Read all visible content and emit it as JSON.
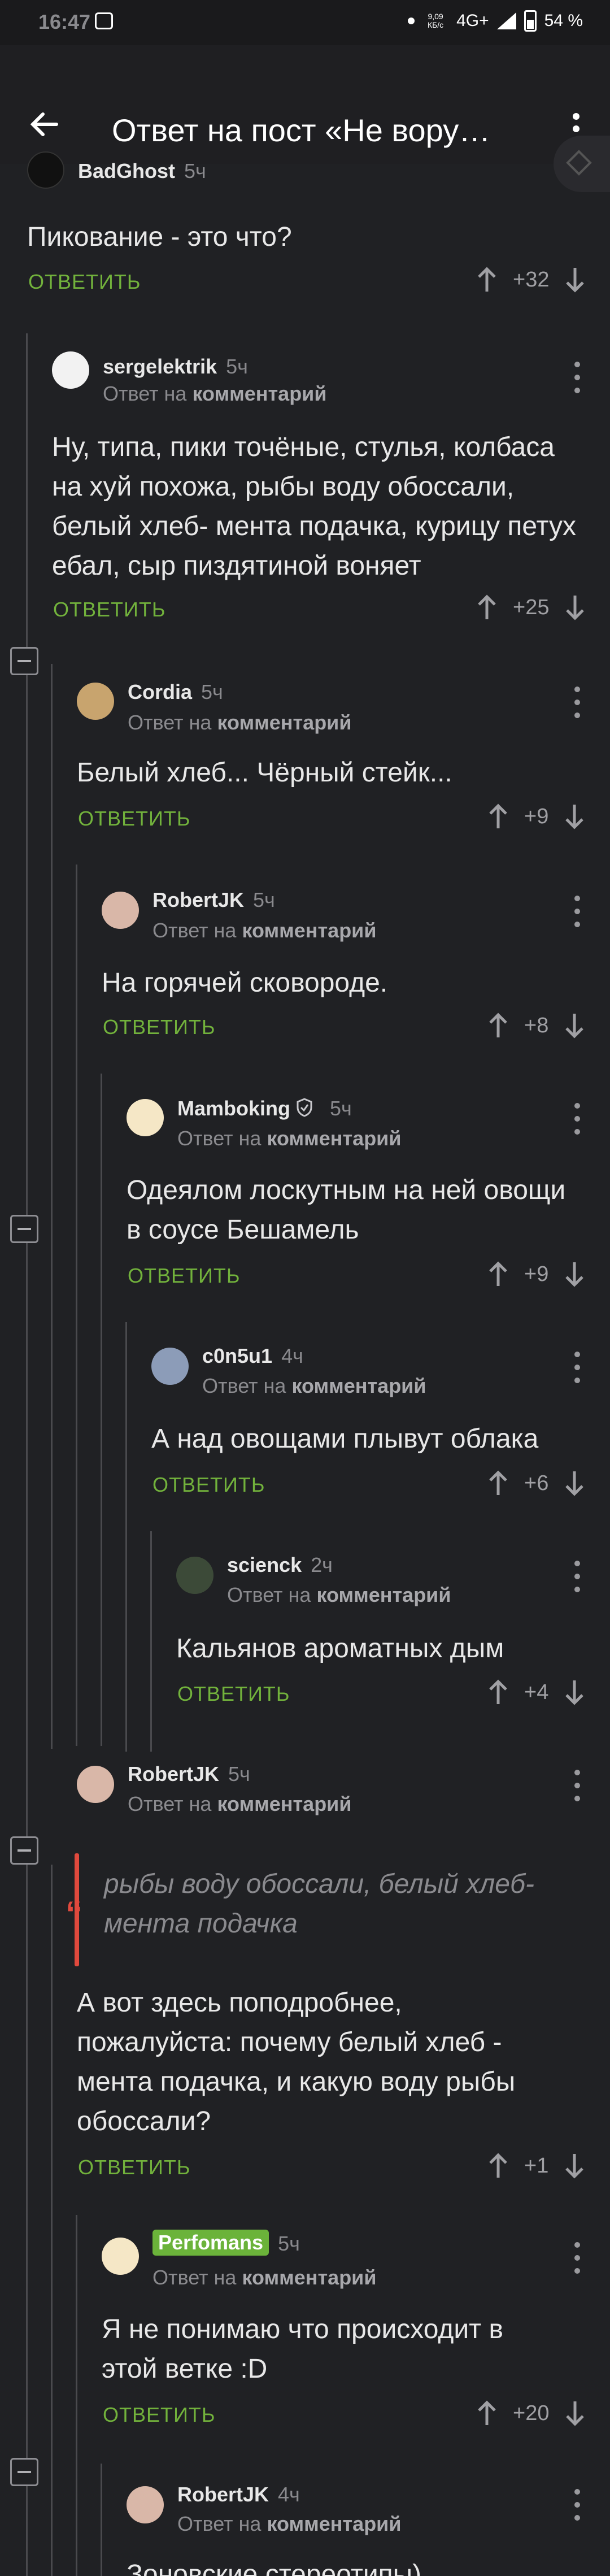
{
  "status": {
    "time": "16:47",
    "net_speed": "9,09 КБ/с",
    "network": "4G+",
    "battery": "54 %"
  },
  "appbar": {
    "title": "Ответ на пост «Не вору…"
  },
  "labels": {
    "answer": "ОТВЕТИТЬ",
    "reply_prefix": "Ответ на",
    "reply_target": "комментарий"
  },
  "comments": [
    {
      "author": "BadGhost",
      "time": "5ч",
      "text": "Пикование - это что?",
      "votes": "+32"
    },
    {
      "author": "sergelektrik",
      "time": "5ч",
      "text": "Ну, типа, пики точёные, стулья, колбаса на хуй похожа, рыбы воду обоссали, белый хлеб- мента подачка, курицу петух ебал, сыр пиздятиной воняет",
      "votes": "+25"
    },
    {
      "author": "Cordia",
      "time": "5ч",
      "text": "Белый хлеб... Чёрный стейк...",
      "votes": "+9"
    },
    {
      "author": "RobertJK",
      "time": "5ч",
      "text": "На горячей сковороде.",
      "votes": "+8"
    },
    {
      "author": "Mamboking",
      "time": "5ч",
      "text": "Одеялом лоскутным на ней овощи в соусе Бешамель",
      "votes": "+9"
    },
    {
      "author": "c0n5u1",
      "time": "4ч",
      "text": "А над овощами плывут облака",
      "votes": "+6"
    },
    {
      "author": "scienck",
      "time": "2ч",
      "text": "Кальянов ароматных дым",
      "votes": "+4"
    },
    {
      "author": "RobertJK",
      "time": "5ч",
      "quote": "рыбы воду обоссали, белый хлеб- мента подачка",
      "text": "А вот здесь поподробнее, пожалуйста: почему белый хлеб - мента подачка, и какую воду рыбы обоссали?",
      "votes": "+1"
    },
    {
      "author": "Perfomans",
      "time": "5ч",
      "text": "Я не понимаю что происходит в этой ветке :D",
      "votes": "+20"
    },
    {
      "author": "RobertJK",
      "time": "4ч",
      "text": "Зоновские стереотипы)",
      "votes": ""
    }
  ],
  "colors": {
    "accent_green": "#72b23c",
    "quote_red": "#e0493d",
    "background": "#202124"
  }
}
